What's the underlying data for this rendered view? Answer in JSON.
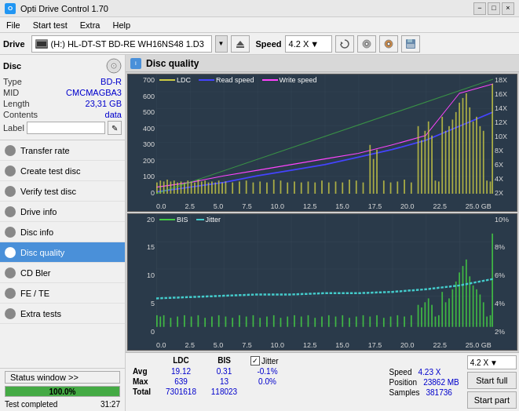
{
  "app": {
    "title": "Opti Drive Control 1.70",
    "icon": "O"
  },
  "title_controls": {
    "minimize": "−",
    "maximize": "□",
    "close": "×"
  },
  "menu": {
    "items": [
      "File",
      "Start test",
      "Extra",
      "Help"
    ]
  },
  "drive_toolbar": {
    "drive_label": "Drive",
    "drive_value": "(H:)  HL-DT-ST BD-RE  WH16NS48 1.D3",
    "speed_label": "Speed",
    "speed_value": "4.2 X"
  },
  "disc": {
    "panel_title": "Disc",
    "type_label": "Type",
    "type_value": "BD-R",
    "mid_label": "MID",
    "mid_value": "CMCMAGBA3",
    "length_label": "Length",
    "length_value": "23,31 GB",
    "contents_label": "Contents",
    "contents_value": "data",
    "label_label": "Label",
    "label_placeholder": ""
  },
  "nav_items": [
    {
      "id": "transfer-rate",
      "label": "Transfer rate",
      "active": false
    },
    {
      "id": "create-test-disc",
      "label": "Create test disc",
      "active": false
    },
    {
      "id": "verify-test-disc",
      "label": "Verify test disc",
      "active": false
    },
    {
      "id": "drive-info",
      "label": "Drive info",
      "active": false
    },
    {
      "id": "disc-info",
      "label": "Disc info",
      "active": false
    },
    {
      "id": "disc-quality",
      "label": "Disc quality",
      "active": true
    },
    {
      "id": "cd-bler",
      "label": "CD Bler",
      "active": false
    },
    {
      "id": "fe-te",
      "label": "FE / TE",
      "active": false
    },
    {
      "id": "extra-tests",
      "label": "Extra tests",
      "active": false
    }
  ],
  "status": {
    "window_btn": "Status window >>",
    "progress_pct": 100,
    "progress_text": "100.0%",
    "time": "31:27",
    "completed": "Test completed"
  },
  "disc_quality": {
    "title": "Disc quality",
    "legend_top": {
      "ldc": "LDC",
      "read_speed": "Read speed",
      "write_speed": "Write speed"
    },
    "legend_bottom": {
      "bis": "BIS",
      "jitter": "Jitter"
    },
    "chart_top": {
      "y_left": [
        "700",
        "600",
        "500",
        "400",
        "300",
        "200",
        "100",
        "0"
      ],
      "y_right": [
        "18X",
        "16X",
        "14X",
        "12X",
        "10X",
        "8X",
        "6X",
        "4X",
        "2X"
      ],
      "x_axis": [
        "0.0",
        "2.5",
        "5.0",
        "7.5",
        "10.0",
        "12.5",
        "15.0",
        "17.5",
        "20.0",
        "22.5",
        "25.0"
      ]
    },
    "chart_bottom": {
      "y_left": [
        "20",
        "15",
        "10",
        "5",
        "0"
      ],
      "y_right": [
        "10%",
        "8%",
        "6%",
        "4%",
        "2%"
      ],
      "x_axis": [
        "0.0",
        "2.5",
        "5.0",
        "7.5",
        "10.0",
        "12.5",
        "15.0",
        "17.5",
        "20.0",
        "22.5",
        "25.0"
      ]
    }
  },
  "stats": {
    "ldc_header": "LDC",
    "bis_header": "BIS",
    "jitter_label": "Jitter",
    "jitter_checked": true,
    "speed_header": "Speed",
    "speed_value": "4.23 X",
    "avg_label": "Avg",
    "avg_ldc": "19.12",
    "avg_bis": "0.31",
    "avg_jitter": "-0.1%",
    "max_label": "Max",
    "max_ldc": "639",
    "max_bis": "13",
    "max_jitter": "0.0%",
    "total_label": "Total",
    "total_ldc": "7301618",
    "total_bis": "118023",
    "position_label": "Position",
    "position_value": "23862 MB",
    "samples_label": "Samples",
    "samples_value": "381736",
    "speed_select": "4.2 X",
    "start_full_btn": "Start full",
    "start_part_btn": "Start part"
  },
  "colors": {
    "ldc_color": "#cccc44",
    "bis_color": "#44cc44",
    "read_speed_color": "#4444ff",
    "write_speed_color": "#ff44ff",
    "jitter_color": "#44cccc",
    "chart_bg": "#2a3a4a",
    "grid_color": "#3a4a5a",
    "accent_blue": "#0000cc",
    "nav_active_bg": "#4a90d9"
  }
}
